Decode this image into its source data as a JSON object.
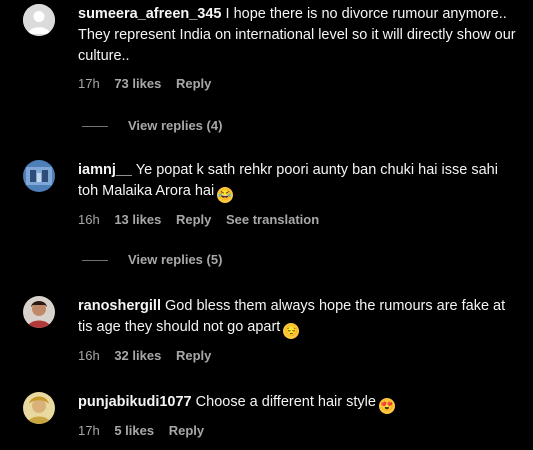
{
  "comments": [
    {
      "username": "sumeera_afreen_345",
      "text": " I hope there is no divorce rumour anymore.. They represent India on international level so it will directly show our culture..",
      "emoji": "",
      "time": "17h",
      "likes": "73 likes",
      "reply": "Reply",
      "translation": "",
      "view_replies": "View replies (4)"
    },
    {
      "username": "iamnj__",
      "text": " Ye popat k sath rehkr poori aunty ban chuki hai isse sahi toh Malaika Arora hai",
      "emoji": "😂",
      "time": "16h",
      "likes": "13 likes",
      "reply": "Reply",
      "translation": "See translation",
      "view_replies": "View replies (5)"
    },
    {
      "username": "ranoshergill",
      "text": " God bless them always hope the rumours are fake at tis age they should not go apart",
      "emoji": "😔",
      "time": "16h",
      "likes": "32 likes",
      "reply": "Reply",
      "translation": "",
      "view_replies": ""
    },
    {
      "username": "punjabikudi1077",
      "text": " Choose a different hair style",
      "emoji": "😍",
      "time": "17h",
      "likes": "5 likes",
      "reply": "Reply",
      "translation": "",
      "view_replies": ""
    }
  ]
}
